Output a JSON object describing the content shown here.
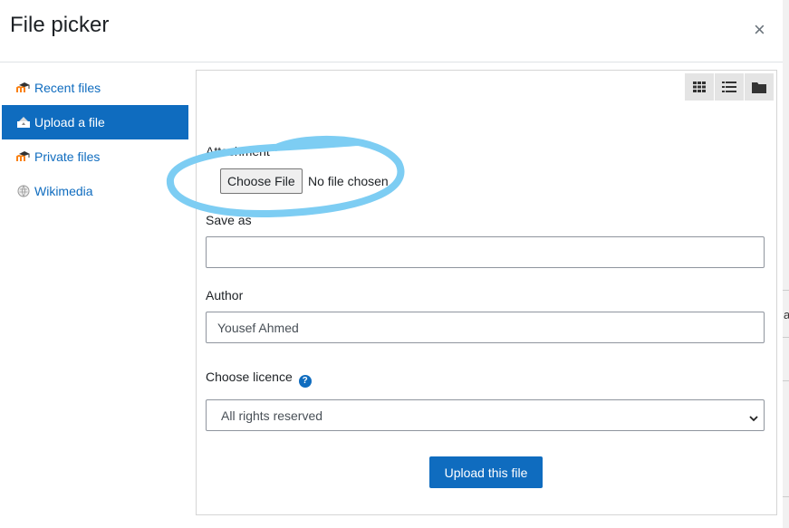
{
  "modal": {
    "title": "File picker",
    "close_glyph": "×"
  },
  "sidebar": {
    "items": [
      {
        "label": "Recent files",
        "icon": "moodle-icon",
        "active": false
      },
      {
        "label": "Upload a file",
        "icon": "upload-icon",
        "active": true
      },
      {
        "label": "Private files",
        "icon": "moodle-icon",
        "active": false
      },
      {
        "label": "Wikimedia",
        "icon": "wikimedia-icon",
        "active": false
      }
    ]
  },
  "viewbar": {
    "icons": [
      "grid-view-icon",
      "list-view-icon",
      "folder-view-icon"
    ]
  },
  "form": {
    "attachment_label": "Attachment",
    "choose_file_label": "Choose File",
    "no_file_text": "No file chosen",
    "save_as_label": "Save as",
    "save_as_value": "",
    "author_label": "Author",
    "author_value": "Yousef Ahmed",
    "licence_label": "Choose licence",
    "licence_value": "All rights reserved",
    "submit_label": "Upload this file"
  },
  "colors": {
    "accent": "#0f6cbf",
    "annotation": "#7dcdf3"
  },
  "background_glyph": "a"
}
